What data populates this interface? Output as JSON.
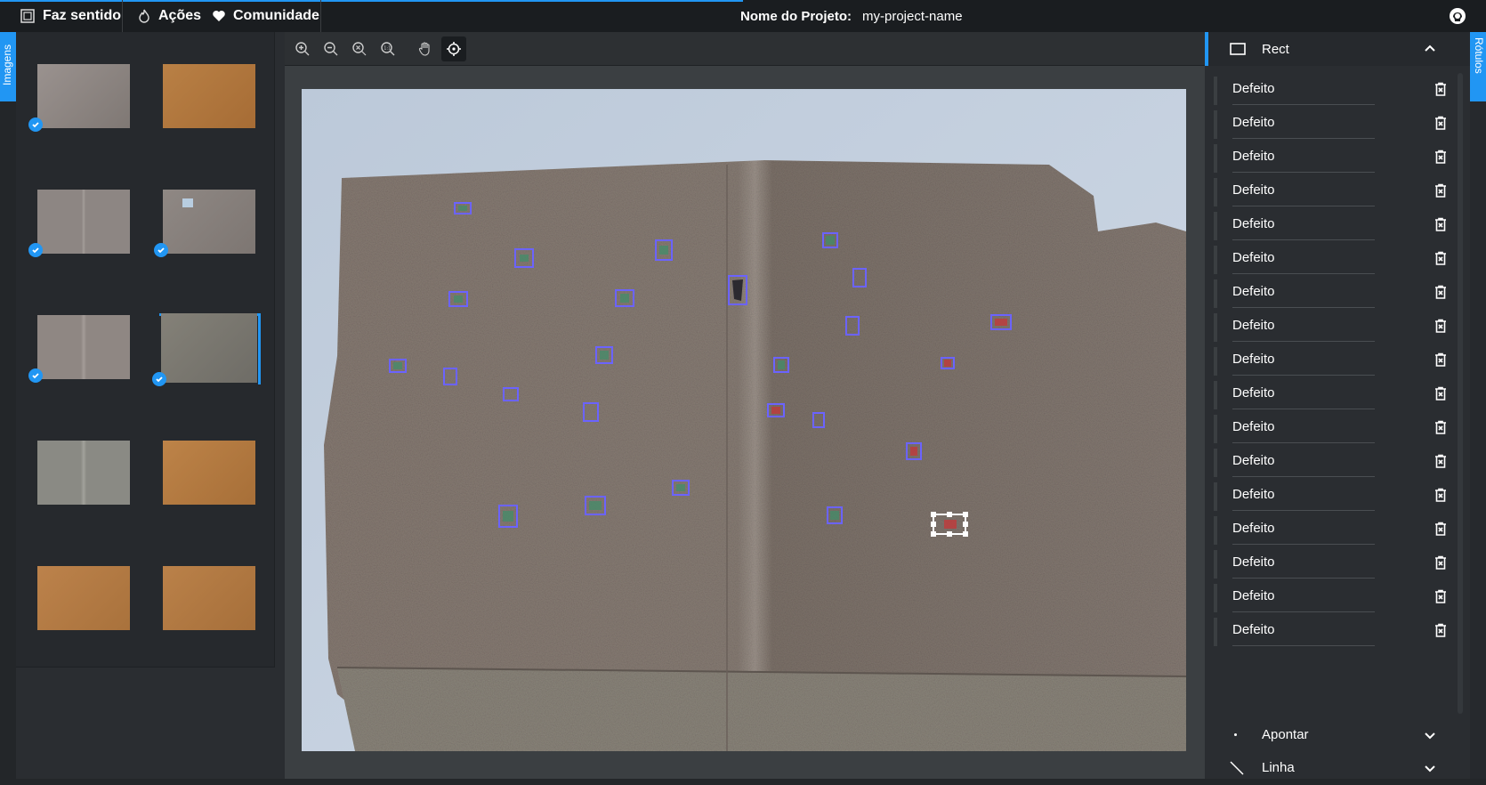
{
  "topbar": {
    "menu": [
      {
        "icon": "frame-icon",
        "label": "Faz sentido"
      },
      {
        "icon": "fire-icon",
        "label": "Ações"
      },
      {
        "icon": "heart-icon",
        "label": "Comunidade"
      }
    ],
    "project_label": "Nome do Projeto:",
    "project_name": "my-project-name",
    "github_icon": "github-icon",
    "accent": "#2196f3"
  },
  "left_tab": {
    "label": "Imagens",
    "icon": "image-icon"
  },
  "right_tab": {
    "label": "Rótulos",
    "icon": "label-icon"
  },
  "thumbnails": [
    {
      "color": "#8e8784",
      "checked": true,
      "selected": false
    },
    {
      "color": "#b0763f",
      "checked": false,
      "selected": false
    },
    {
      "color": "#8d8683",
      "checked": true,
      "selected": false
    },
    {
      "color": "#8a837f",
      "checked": true,
      "selected": false
    },
    {
      "color": "#8f8783",
      "checked": true,
      "selected": false
    },
    {
      "color": "#7a7872",
      "checked": true,
      "selected": true
    },
    {
      "color": "#8a8a84",
      "checked": false,
      "selected": false
    },
    {
      "color": "#b27a42",
      "checked": false,
      "selected": false
    },
    {
      "color": "#b57b46",
      "checked": false,
      "selected": false
    },
    {
      "color": "#b37a45",
      "checked": false,
      "selected": false
    }
  ],
  "toolbar": {
    "tools": [
      "zoom-in-icon",
      "zoom-out-icon",
      "zoom-fit-icon",
      "zoom-reset-icon",
      "hand-icon",
      "crosshair-icon"
    ],
    "active": "crosshair-icon"
  },
  "right_panel": {
    "rect_title": "Rect",
    "labels": [
      "Defeito",
      "Defeito",
      "Defeito",
      "Defeito",
      "Defeito",
      "Defeito",
      "Defeito",
      "Defeito",
      "Defeito",
      "Defeito",
      "Defeito",
      "Defeito",
      "Defeito",
      "Defeito",
      "Defeito",
      "Defeito",
      "Defeito"
    ],
    "point_title": "Apontar",
    "line_title": "Linha"
  }
}
